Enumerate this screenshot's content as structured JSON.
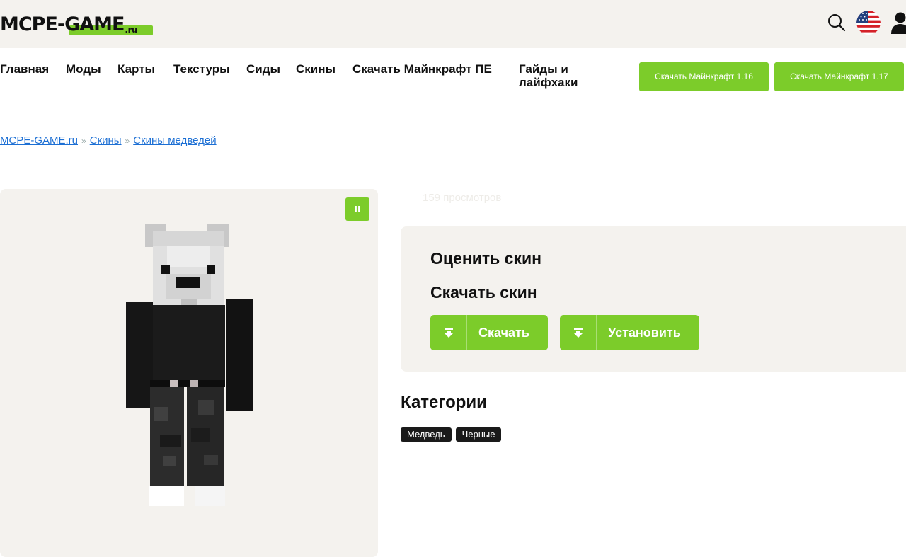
{
  "header": {
    "logo_main": "MCPE-GAME",
    "logo_suffix": ".ru"
  },
  "icons": {
    "search": "search-icon",
    "language": "us-flag-icon",
    "user": "user-icon",
    "pause": "pause-icon",
    "download": "download-icon"
  },
  "nav": {
    "items": [
      {
        "label": "Главная"
      },
      {
        "label": "Моды"
      },
      {
        "label": "Карты"
      },
      {
        "label": "Текстуры"
      },
      {
        "label": "Сиды"
      },
      {
        "label": "Скины"
      },
      {
        "label": "Скачать Майнкрафт ПЕ"
      },
      {
        "label": "Гайды и лайфхаки"
      }
    ],
    "buttons": [
      {
        "label": "Скачать Майнкрафт 1.16"
      },
      {
        "label": "Скачать Майнкрафт 1.17"
      }
    ]
  },
  "breadcrumb": {
    "items": [
      "MCPE-GAME.ru",
      "Скины",
      "Скины медведей"
    ],
    "separator": "»"
  },
  "skin": {
    "views": "159 просмотров",
    "pause_label": "II"
  },
  "panel": {
    "rate_title": "Оценить скин",
    "download_title": "Скачать скин",
    "download_label": "Скачать",
    "install_label": "Установить"
  },
  "categories": {
    "title": "Категории",
    "tags": [
      "Медведь",
      "Черные"
    ]
  },
  "colors": {
    "accent": "#7ccc2a",
    "link": "#1c6fd4",
    "panel_bg": "#f4f2ee",
    "tag_bg": "#1a1a1a"
  }
}
